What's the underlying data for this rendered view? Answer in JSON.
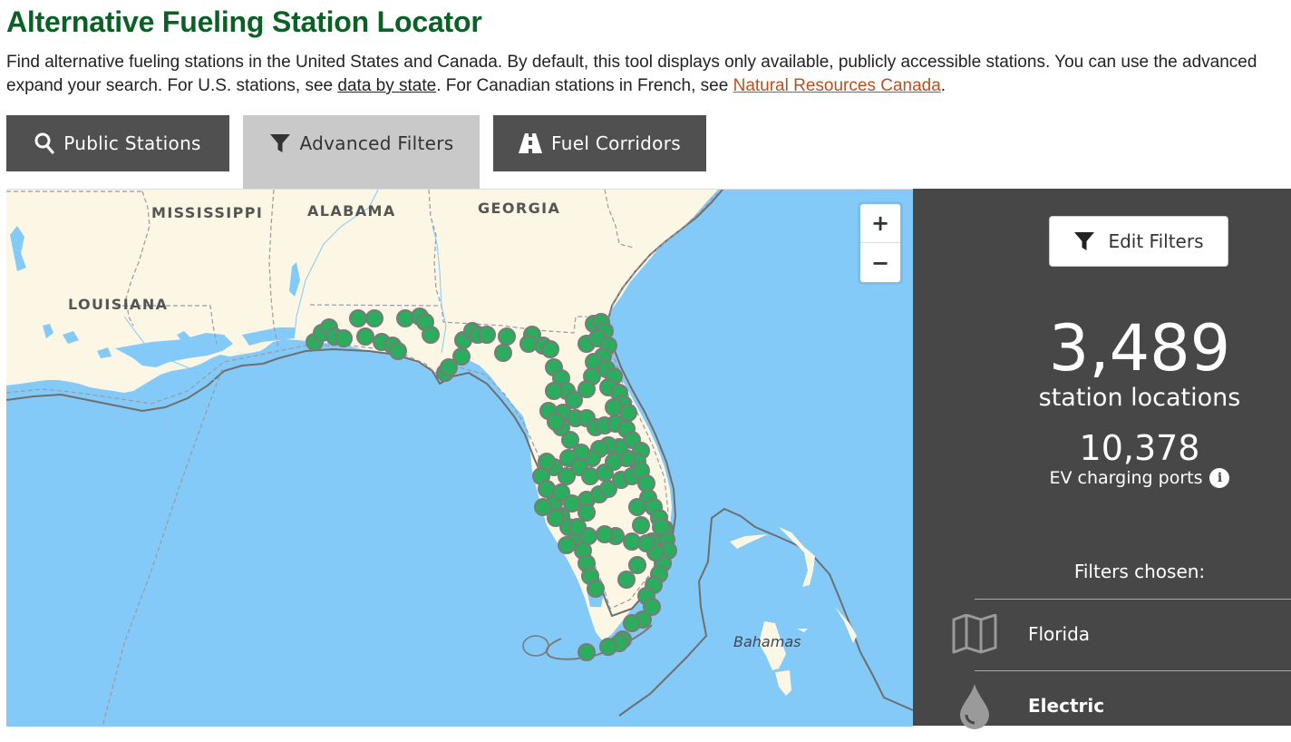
{
  "header": {
    "title": "Alternative Fueling Station Locator",
    "intro_part1": "Find alternative fueling stations in the United States and Canada. By default, this tool displays only available, publicly accessible stations. You can use the advanced",
    "intro_part2": "expand your search. For U.S. stations, see ",
    "link_data_by_state": "data by state",
    "intro_part3": ". For Canadian stations in French, see ",
    "link_nrcan": "Natural Resources Canada",
    "intro_part4": "."
  },
  "tabs": [
    {
      "label": "Public Stations",
      "icon": "search-icon",
      "active": false
    },
    {
      "label": "Advanced Filters",
      "icon": "filter-icon",
      "active": true
    },
    {
      "label": "Fuel Corridors",
      "icon": "road-icon",
      "active": false
    }
  ],
  "map": {
    "labels": {
      "mississippi": "MISSISSIPPI",
      "alabama": "ALABAMA",
      "georgia": "GEORGIA",
      "louisiana": "LOUISIANA",
      "bahamas": "Bahamas"
    },
    "zoom_in": "+",
    "zoom_out": "−",
    "marker_color": "#2aad5c",
    "water_color": "#83caf8",
    "land_color": "#fcf6e4"
  },
  "panel": {
    "edit_filters_label": "Edit Filters",
    "station_count": "3,489",
    "station_count_label": "station locations",
    "ports_count": "10,378",
    "ports_label": "EV charging ports",
    "filters_title": "Filters chosen:",
    "filters": [
      {
        "icon": "map-icon",
        "label": "Florida"
      },
      {
        "icon": "drop-icon",
        "label": "Electric"
      }
    ]
  }
}
